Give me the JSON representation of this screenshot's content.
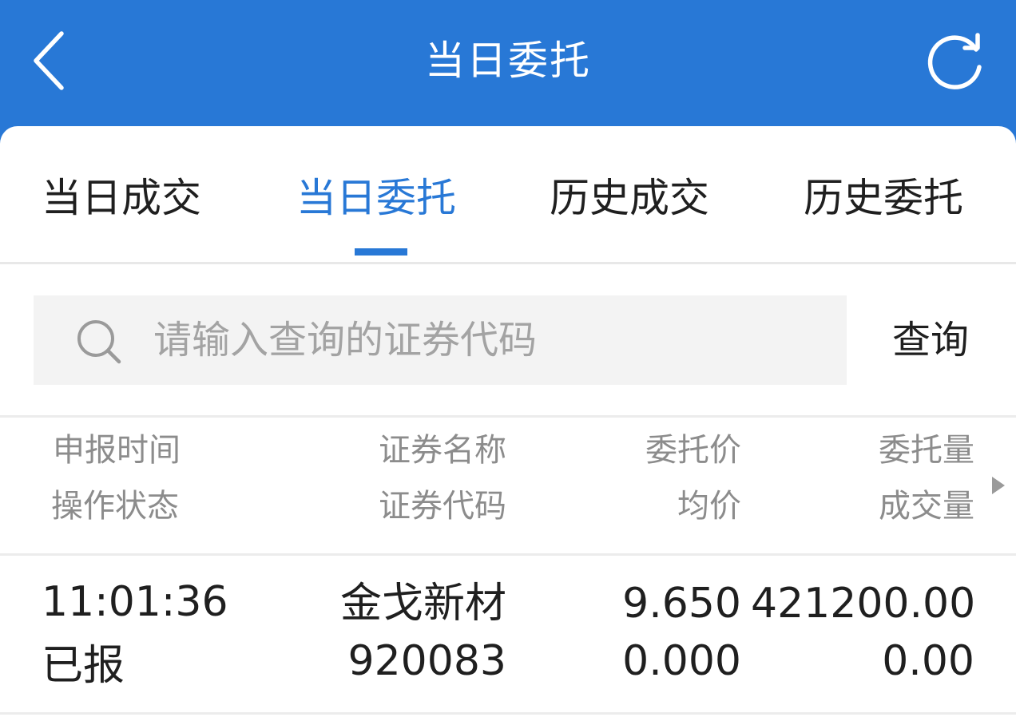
{
  "appbar": {
    "title": "当日委托",
    "background_color": "#2878d6",
    "back_icon": "chevron-left-icon",
    "refresh_icon": "refresh-icon"
  },
  "tabs": [
    {
      "label": "当日成交",
      "active": false
    },
    {
      "label": "当日委托",
      "active": true
    },
    {
      "label": "历史成交",
      "active": false
    },
    {
      "label": "历史委托",
      "active": false
    }
  ],
  "search": {
    "placeholder": "请输入查询的证券代码",
    "value": "",
    "icon": "search-icon",
    "button_label": "查询"
  },
  "table": {
    "headers": [
      {
        "line1": "申报时间",
        "line2": "操作状态"
      },
      {
        "line1": "证券名称",
        "line2": "证券代码"
      },
      {
        "line1": "委托价",
        "line2": "均价"
      },
      {
        "line1": "委托量",
        "line2": "成交量"
      }
    ],
    "rows": [
      {
        "time": "11:01:36",
        "status": "已报",
        "name": "金戈新材",
        "code": "920083",
        "price": "9.650",
        "avg_price": "0.000",
        "quantity": "421200.00",
        "filled": "0.00"
      }
    ],
    "more_columns_icon": "triangle-right-icon"
  },
  "colors": {
    "accent": "#2878d6",
    "text": "#1f1f1f",
    "muted": "#8c8c8c",
    "placeholder": "#a3a3a3"
  }
}
